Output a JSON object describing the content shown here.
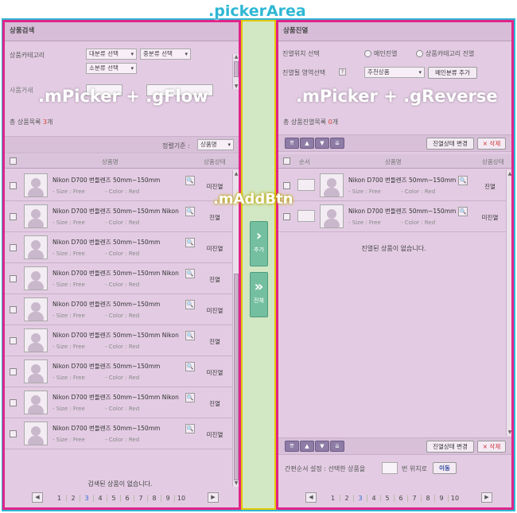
{
  "annotations": {
    "picker_area": ".pickerArea",
    "left_picker": ".mPicker + .gFlow",
    "right_picker": ".mPicker + .gReverse",
    "add_btn": ".mAddBtn"
  },
  "left": {
    "title": "상품검색",
    "category_label": "상품카테고리",
    "selects": {
      "large": "대분류 선택",
      "medium": "중분류 선택",
      "small": "소분류 선택"
    },
    "search_label": "사품거새",
    "count_label": "총 상품목록",
    "count_value": "3",
    "count_unit": "개",
    "sort_label": "정렬기준 :",
    "sort_value": "상품명",
    "col_name": "상품명",
    "col_status": "상품상태",
    "rows": [
      {
        "name": "Nikon D700 번들렌즈 50mm~150mm",
        "size": "- Size : Free",
        "color": "- Color : Red",
        "status": "미진열"
      },
      {
        "name": "Nikon D700 번들렌즈 50mm~150mm Nikon",
        "size": "- Size : Free",
        "color": "- Color : Red",
        "status": "진열"
      },
      {
        "name": "Nikon D700 번들렌즈 50mm~150mm",
        "size": "- Size : Free",
        "color": "- Color : Red",
        "status": "미진열"
      },
      {
        "name": "Nikon D700 번들렌즈 50mm~150mm Nikon",
        "size": "- Size : Free",
        "color": "- Color : Red",
        "status": "진열"
      },
      {
        "name": "Nikon D700 번들렌즈 50mm~150mm",
        "size": "- Size : Free",
        "color": "- Color : Red",
        "status": "미진열"
      },
      {
        "name": "Nikon D700 번들렌즈 50mm~150mm Nikon",
        "size": "- Size : Free",
        "color": "- Color : Red",
        "status": "진열"
      },
      {
        "name": "Nikon D700 번들렌즈 50mm~150mm",
        "size": "- Size : Free",
        "color": "- Color : Red",
        "status": "미진열"
      },
      {
        "name": "Nikon D700 번들렌즈 50mm~150mm Nikon",
        "size": "- Size : Free",
        "color": "- Color : Red",
        "status": "진열"
      },
      {
        "name": "Nikon D700 번들렌즈 50mm~150mm",
        "size": "- Size : Free",
        "color": "- Color : Red",
        "status": "미진열"
      }
    ],
    "empty_text": "검색된 상품이 없습니다.",
    "pages": [
      "1",
      "2",
      "3",
      "4",
      "5",
      "6",
      "7",
      "8",
      "9",
      "10"
    ],
    "current_page": "3"
  },
  "add": {
    "add_label": "추가",
    "add_all_label": "전체",
    "add_glyph": "›",
    "add_all_glyph": "»"
  },
  "right": {
    "title": "상품진열",
    "location_label": "진열위치 선택",
    "radio_main": "메인진열",
    "radio_category": "상품카테고리 진열",
    "area_label": "진열될 영역선택",
    "area_help": "?",
    "area_value": "추천상품",
    "add_main_button": "메인분류 추가",
    "count_label": "총 상품진열목록",
    "count_value": "0",
    "count_unit": "개",
    "status_change_button": "진열상태 변경",
    "delete_button": "× 삭제",
    "col_order": "순서",
    "col_name": "상품명",
    "col_status": "상품상태",
    "rows": [
      {
        "name": "Nikon D700 번들렌즈 50mm~150mm",
        "size": "- Size : Free",
        "color": "- Color : Red",
        "status": "진열"
      },
      {
        "name": "Nikon D700 번들렌즈 50mm~150mm",
        "size": "- Size : Free",
        "color": "- Color : Red",
        "status": "미진열"
      }
    ],
    "empty_text": "진열된 상품이 없습니다.",
    "order_setting_label": "간편순서 설정 : 선택한 상품을",
    "order_position_suffix": "번 위치로",
    "move_button": "이동",
    "pages": [
      "1",
      "2",
      "3",
      "4",
      "5",
      "6",
      "7",
      "8",
      "9",
      "10"
    ],
    "current_page": "3"
  },
  "icons": {
    "move_top": "⇈",
    "move_up": "▲",
    "move_down": "▼",
    "move_bottom": "⇊",
    "zoom": "🔍",
    "prev": "◀",
    "next": "▶",
    "dropdown": "▾"
  },
  "colors": {
    "panel_bg": "#e3cce3",
    "panel_border": "#e0248a",
    "area_border": "#2fb7d4",
    "add_col_bg": "#d2e7c3",
    "add_col_border": "#e4c800",
    "current_page": "#2a6bd4",
    "count_highlight": "#d8402e"
  }
}
